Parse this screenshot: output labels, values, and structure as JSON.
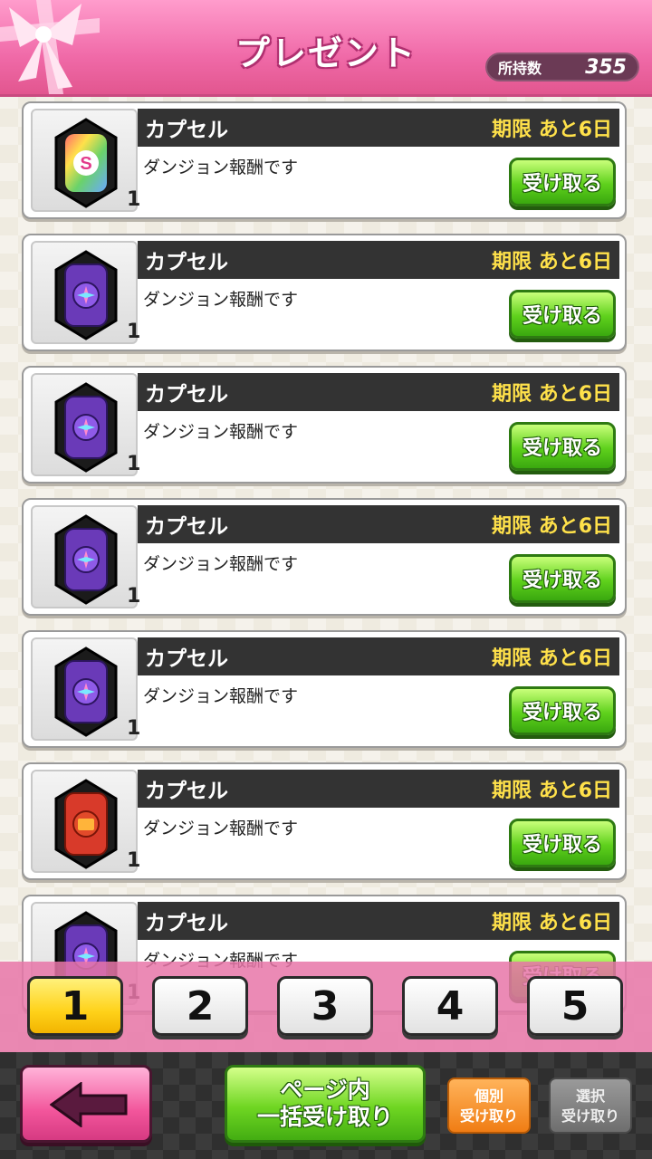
{
  "header": {
    "title": "プレゼント",
    "count_label": "所持数",
    "count_value": "355"
  },
  "items": [
    {
      "name": "カプセル",
      "deadline": "期限 あと6日",
      "description": "ダンジョン報酬です",
      "quantity": "1",
      "button": "受け取る",
      "capsule": "rainbow-s"
    },
    {
      "name": "カプセル",
      "deadline": "期限 あと6日",
      "description": "ダンジョン報酬です",
      "quantity": "1",
      "button": "受け取る",
      "capsule": "purple"
    },
    {
      "name": "カプセル",
      "deadline": "期限 あと6日",
      "description": "ダンジョン報酬です",
      "quantity": "1",
      "button": "受け取る",
      "capsule": "purple"
    },
    {
      "name": "カプセル",
      "deadline": "期限 あと6日",
      "description": "ダンジョン報酬です",
      "quantity": "1",
      "button": "受け取る",
      "capsule": "purple"
    },
    {
      "name": "カプセル",
      "deadline": "期限 あと6日",
      "description": "ダンジョン報酬です",
      "quantity": "1",
      "button": "受け取る",
      "capsule": "purple"
    },
    {
      "name": "カプセル",
      "deadline": "期限 あと6日",
      "description": "ダンジョン報酬です",
      "quantity": "1",
      "button": "受け取る",
      "capsule": "red"
    },
    {
      "name": "カプセル",
      "deadline": "期限 あと6日",
      "description": "ダンジョン報酬です",
      "quantity": "1",
      "button": "受け取る",
      "capsule": "purple"
    }
  ],
  "pager": {
    "pages": [
      "1",
      "2",
      "3",
      "4",
      "5"
    ],
    "current": "1"
  },
  "footer": {
    "back_icon": "left-arrow-icon",
    "bulk_line1": "ページ内",
    "bulk_line2": "一括受け取り",
    "individual_line1": "個別",
    "individual_line2": "受け取り",
    "select_line1": "選択",
    "select_line2": "受け取り"
  },
  "colors": {
    "header_pink": "#f06aa8",
    "receive_green": "#5fd11c",
    "deadline_yellow": "#ffe14a",
    "active_page": "#ffd21a",
    "individual_orange": "#f07d14"
  }
}
